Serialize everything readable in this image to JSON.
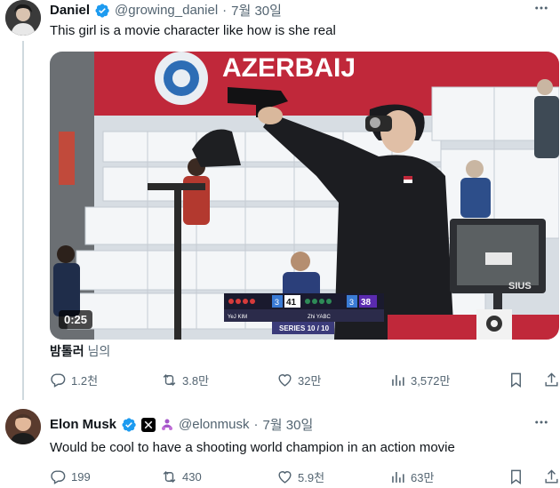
{
  "tweet1": {
    "author": {
      "name": "Daniel",
      "handle": "@growing_daniel",
      "dot": "·",
      "date": "7월 30일"
    },
    "text": "This girl is a movie character like how is she real",
    "media": {
      "duration": "0:25",
      "banner_text": "AZERBAIJ",
      "scoreboard": {
        "row1": {
          "player": "YeJ KIM",
          "score": "41",
          "series": "3"
        },
        "row2": {
          "player": "Zhi YABC",
          "score": "38",
          "series": "3"
        },
        "series_label": "SERIES 10 / 10"
      },
      "monitor_brand": "SIUS"
    },
    "translated_by": {
      "name": "밤톨러",
      "suffix": "님의"
    },
    "actions": {
      "replies": "1.2천",
      "retweets": "3.8만",
      "likes": "32만",
      "views": "3,572만"
    }
  },
  "tweet2": {
    "author": {
      "name": "Elon Musk",
      "handle": "@elonmusk",
      "dot": "·",
      "date": "7월 30일"
    },
    "text": "Would be cool to have a shooting world champion in an action movie",
    "actions": {
      "replies": "199",
      "retweets": "430",
      "likes": "5.9천",
      "views": "63만"
    }
  },
  "colors": {
    "text_primary": "#0f1419",
    "text_secondary": "#536471",
    "verified_blue": "#1d9bf0",
    "thread_line": "#cfd9de"
  },
  "icons": [
    "verified-badge-icon",
    "more-icon",
    "reply-icon",
    "retweet-icon",
    "like-icon",
    "views-icon",
    "bookmark-icon",
    "share-icon",
    "x-affiliate-icon",
    "people-icon"
  ]
}
